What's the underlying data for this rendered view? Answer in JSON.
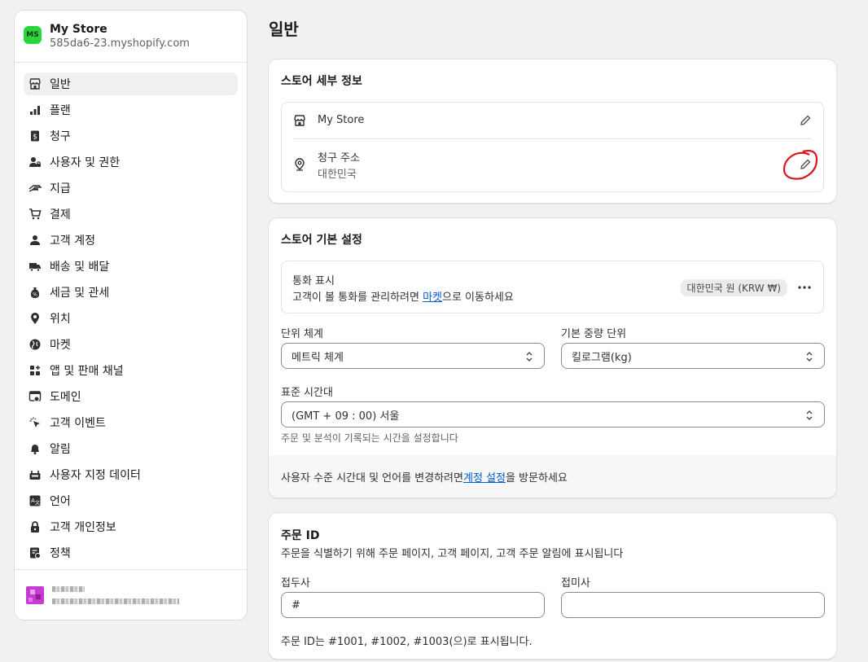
{
  "store": {
    "avatar_initials": "MS",
    "name": "My Store",
    "domain": "585da6-23.myshopify.com"
  },
  "sidebar": {
    "items": [
      {
        "label": "일반",
        "icon": "store-icon",
        "active": true
      },
      {
        "label": "플랜",
        "icon": "plan-chart-icon"
      },
      {
        "label": "청구",
        "icon": "billing-icon"
      },
      {
        "label": "사용자 및 권한",
        "icon": "users-lock-icon"
      },
      {
        "label": "지급",
        "icon": "payouts-hand-icon"
      },
      {
        "label": "결제",
        "icon": "cart-icon"
      },
      {
        "label": "고객 계정",
        "icon": "person-icon"
      },
      {
        "label": "배송 및 배달",
        "icon": "truck-icon"
      },
      {
        "label": "세금 및 관세",
        "icon": "tax-bag-icon"
      },
      {
        "label": "위치",
        "icon": "location-pin-icon"
      },
      {
        "label": "마켓",
        "icon": "globe-icon"
      },
      {
        "label": "앱 및 판매 채널",
        "icon": "apps-icon"
      },
      {
        "label": "도메인",
        "icon": "domain-icon"
      },
      {
        "label": "고객 이벤트",
        "icon": "cursor-click-icon"
      },
      {
        "label": "알림",
        "icon": "bell-icon"
      },
      {
        "label": "사용자 지정 데이터",
        "icon": "custom-data-icon"
      },
      {
        "label": "언어",
        "icon": "language-icon"
      },
      {
        "label": "고객 개인정보",
        "icon": "lock-icon"
      },
      {
        "label": "정책",
        "icon": "policy-icon"
      }
    ]
  },
  "page": {
    "title": "일반"
  },
  "store_details": {
    "title": "스토어 세부 정보",
    "store_name": "My Store",
    "billing_label": "청구 주소",
    "billing_value": "대한민국"
  },
  "store_defaults": {
    "title": "스토어 기본 설정",
    "currency_label": "통화 표시",
    "currency_desc_prefix": "고객이 볼 통화를 관리하려면 ",
    "currency_desc_link": "마켓",
    "currency_desc_suffix": "으로 이동하세요",
    "currency_badge": "대한민국 원 (KRW ₩)",
    "unit_system_label": "단위 체계",
    "unit_system_value": "메트릭 체계",
    "weight_unit_label": "기본 중량 단위",
    "weight_unit_value": "킬로그램(kg)",
    "timezone_label": "표준 시간대",
    "timezone_value": "(GMT + 09 : 00) 서울",
    "timezone_help": "주문 및 분석이 기록되는 시간을 설정합니다",
    "footer_prefix": "사용자 수준 시간대 및 언어를 변경하려면 ",
    "footer_link": "계정 설정",
    "footer_suffix": "을 방문하세요"
  },
  "order_id": {
    "title": "주문 ID",
    "desc": "주문을 식별하기 위해 주문 페이지, 고객 페이지, 고객 주문 알림에 표시됩니다",
    "prefix_label": "접두사",
    "prefix_value": "#",
    "suffix_label": "접미사",
    "suffix_value": "",
    "preview": "주문 ID는 #1001, #1002, #1003(으)로 표시됩니다."
  },
  "colors": {
    "avatar_green": "#2bd63a",
    "link_blue": "#005bd3",
    "annotation_red": "#e0121b"
  }
}
